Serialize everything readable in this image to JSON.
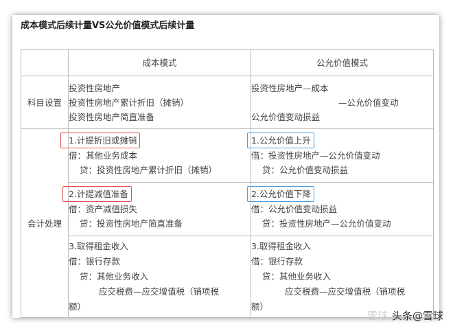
{
  "title": "成本模式后续计量VS公允价值模式后续计量",
  "headers": [
    "",
    "成本模式",
    "公允价值模式"
  ],
  "rows": {
    "subjects": {
      "label": "科目设置",
      "cost": [
        "投资性房地产",
        "投资性房地产累计折旧（摊销）",
        "投资性房地产简直准备"
      ],
      "fair": [
        "投资性房地产—成本",
        "—公允价值变动",
        "公允价值变动损益"
      ]
    },
    "accounting_label": "会计处理",
    "r1": {
      "cost_head": "1.计提折旧或摊销",
      "cost": [
        "借：其他业务成本",
        "贷：投资性房地产累计折旧（摊销）"
      ],
      "fair_head": "1.公允价值上升",
      "fair": [
        "借：投资性房地产—公允价值变动",
        "贷：公允价值变动损益"
      ]
    },
    "r2": {
      "cost_head": "2.计提减值准备",
      "cost": [
        "借：资产减值损失",
        "贷：投资性房地产简直准备"
      ],
      "fair_head": "2.公允价值下降",
      "fair": [
        "借：公允价值变动损益",
        "贷：投资性房地产—公允价值变动"
      ]
    },
    "r3": {
      "cost": [
        "3.取得租金收入",
        "借：银行存款",
        "贷：其他业务收入",
        "应交税费—应交增值税（销项税",
        "额）"
      ],
      "fair": [
        "3.取得租金收入",
        "借：银行存款",
        "贷：其他业务收入",
        "应交税费—应交增值税（销项税",
        "额）"
      ]
    }
  },
  "watermark": {
    "logo": "雪球",
    "text": "头条@雪球"
  }
}
